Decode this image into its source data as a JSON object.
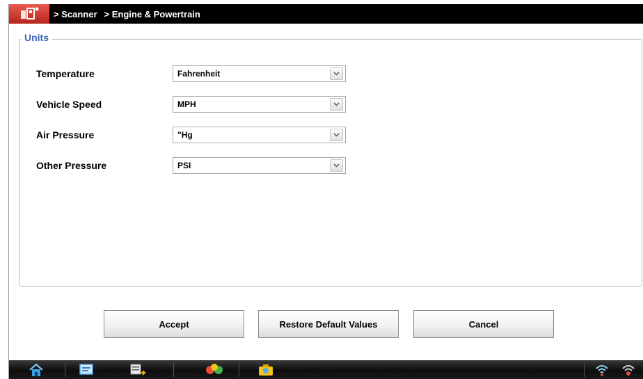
{
  "titlebar": {
    "app_icon": "scanner-app-icon",
    "breadcrumb": [
      "> Scanner",
      "> Engine & Powertrain"
    ]
  },
  "units": {
    "legend": "Units",
    "rows": [
      {
        "label": "Temperature",
        "value": "Fahrenheit"
      },
      {
        "label": "Vehicle Speed",
        "value": "MPH"
      },
      {
        "label": "Air Pressure",
        "value": "\"Hg"
      },
      {
        "label": "Other Pressure",
        "value": "PSI"
      }
    ]
  },
  "buttons": {
    "accept": "Accept",
    "restore": "Restore Default Values",
    "cancel": "Cancel"
  },
  "taskbar": {
    "items": [
      "home-icon",
      "screen-icon",
      "data-icon",
      "tools-icon",
      "camera-icon"
    ],
    "status": [
      "wifi-icon",
      "wifi-connect-icon"
    ]
  },
  "colors": {
    "legend": "#3a63b8",
    "titlebar": "#000000",
    "app_icon": "#d33a2f"
  }
}
